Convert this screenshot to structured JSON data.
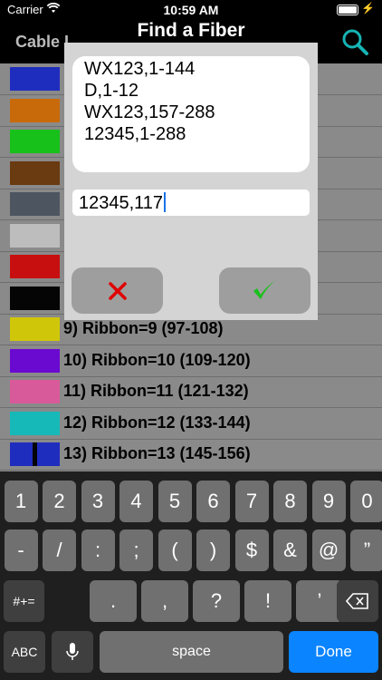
{
  "status_bar": {
    "carrier": "Carrier",
    "time": "10:59 AM"
  },
  "nav": {
    "left_label": "Cable I",
    "title": "Find a Fiber",
    "search_icon": "search-icon"
  },
  "rows": [
    {
      "color": "#1f2dbe",
      "label": ""
    },
    {
      "color": "#c86a0a",
      "label": ""
    },
    {
      "color": "#18c01a",
      "label": ""
    },
    {
      "color": "#6a3a10",
      "label": ""
    },
    {
      "color": "#4d5660",
      "label": ""
    },
    {
      "color": "#bdbdbd",
      "label": ""
    },
    {
      "color": "#c80f0f",
      "label": ""
    },
    {
      "color": "#050505",
      "label": ""
    },
    {
      "color": "#cfc60a",
      "label": "9) Ribbon=9 (97-108)"
    },
    {
      "color": "#6a0ad0",
      "label": "10) Ribbon=10 (109-120)"
    },
    {
      "color": "#d85a9a",
      "label": "11) Ribbon=11 (121-132)"
    },
    {
      "color": "#17b8b8",
      "label": "12) Ribbon=12 (133-144)"
    },
    {
      "color": "#1f2dbe",
      "label": "13) Ribbon=13 (145-156)",
      "stripe": "#050505"
    }
  ],
  "dialog": {
    "lines": [
      "WX123,1-144",
      "D,1-12",
      "WX123,157-288",
      "12345,1-288"
    ],
    "input_value": "12345,117",
    "cancel_icon": "x-icon",
    "confirm_icon": "check-icon",
    "cancel_color": "#e00000",
    "confirm_color": "#18c01a"
  },
  "keyboard": {
    "row1": [
      "1",
      "2",
      "3",
      "4",
      "5",
      "6",
      "7",
      "8",
      "9",
      "0"
    ],
    "row2": [
      "-",
      "/",
      ":",
      ";",
      "(",
      ")",
      "$",
      "&",
      "@",
      "”"
    ],
    "row3_left": "#+=",
    "row3": [
      ".",
      ",",
      "?",
      "!",
      "’"
    ],
    "backspace_icon": "backspace-icon",
    "abc": "ABC",
    "mic_icon": "mic-icon",
    "space": "space",
    "done": "Done"
  }
}
